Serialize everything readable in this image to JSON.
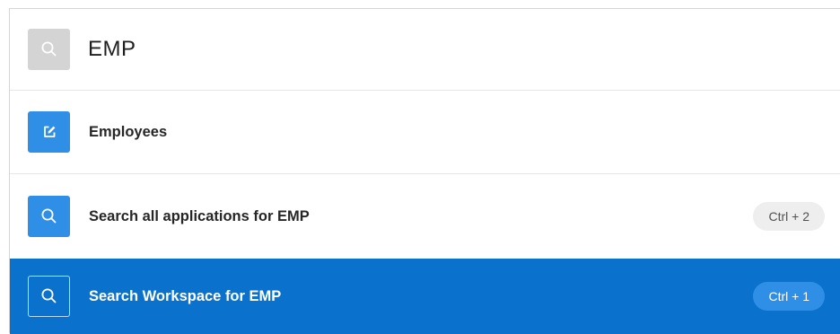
{
  "search": {
    "value": "EMP",
    "icon": "search-icon"
  },
  "results": [
    {
      "label": "Employees",
      "icon": "edit-icon",
      "shortcut": ""
    },
    {
      "label": "Search all applications for EMP",
      "icon": "search-icon",
      "shortcut": "Ctrl + 2"
    },
    {
      "label": "Search Workspace for EMP",
      "icon": "search-icon",
      "shortcut": "Ctrl + 1",
      "selected": true
    }
  ],
  "colors": {
    "accent": "#2f8fe6",
    "selected_row": "#0a72cc",
    "search_icon_bg": "#d4d4d4"
  }
}
